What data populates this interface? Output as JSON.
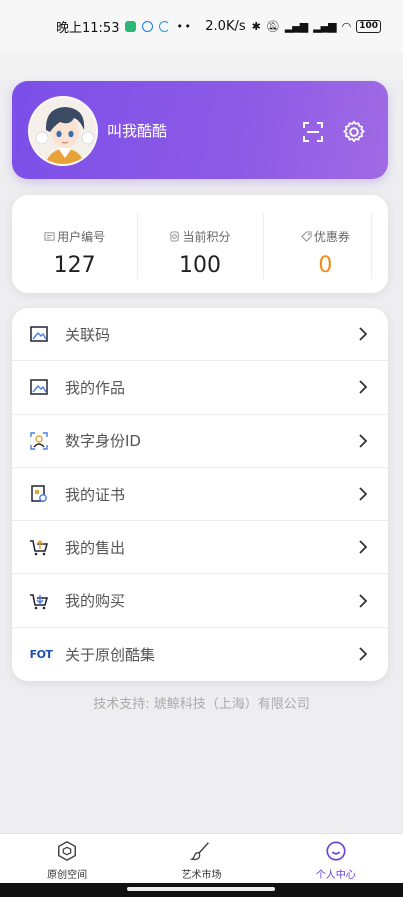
{
  "status_bar": {
    "time": "晚上11:53",
    "network_speed": "2.0K/s",
    "battery": "100"
  },
  "profile": {
    "username": "叫我酷酷"
  },
  "stats": [
    {
      "label": "用户编号",
      "value": "127",
      "icon": "id-icon"
    },
    {
      "label": "当前积分",
      "value": "100",
      "icon": "points-icon"
    },
    {
      "label": "优惠券",
      "value": "0",
      "icon": "coupon-icon"
    }
  ],
  "menu": {
    "items": [
      {
        "label": "关联码",
        "icon": "image-icon"
      },
      {
        "label": "我的作品",
        "icon": "image-icon"
      },
      {
        "label": "数字身份ID",
        "icon": "identity-icon"
      },
      {
        "label": "我的证书",
        "icon": "certificate-icon"
      },
      {
        "label": "我的售出",
        "icon": "cart-upload-icon"
      },
      {
        "label": "我的购买",
        "icon": "cart-download-icon"
      },
      {
        "label": "关于原创酷集",
        "icon": "fot-logo-icon",
        "logo_text": "FOT"
      }
    ]
  },
  "footer": {
    "support_text": "技术支持: 琥鲸科技（上海）有限公司"
  },
  "tabbar": {
    "tabs": [
      {
        "label": "原创空间",
        "active": false
      },
      {
        "label": "艺术市场",
        "active": false
      },
      {
        "label": "个人中心",
        "active": true
      }
    ]
  },
  "colors": {
    "accent": "#7b4fe8",
    "coupon_value": "#f08c1c"
  }
}
